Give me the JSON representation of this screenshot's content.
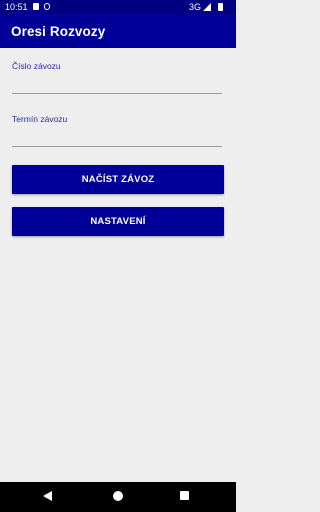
{
  "status_bar": {
    "time": "10:51",
    "network": "3G"
  },
  "app_bar": {
    "title": "Oresi Rozvozy"
  },
  "form": {
    "number_label": "Číslo závozu",
    "number_value": "",
    "term_label": "Termín závozu",
    "term_value": ""
  },
  "buttons": {
    "load_label": "NAČÍST ZÁVOZ",
    "settings_label": "NASTAVENÍ"
  },
  "colors": {
    "primary": "#000099",
    "status_bar": "#000080",
    "label": "#2b2ba8",
    "background": "#eeeeee"
  },
  "icons": {
    "notification_1": "sim-card-icon",
    "notification_2": "sync-icon",
    "signal": "signal-icon",
    "battery": "battery-icon",
    "nav_back": "back-triangle-icon",
    "nav_home": "home-circle-icon",
    "nav_recents": "recents-square-icon"
  }
}
